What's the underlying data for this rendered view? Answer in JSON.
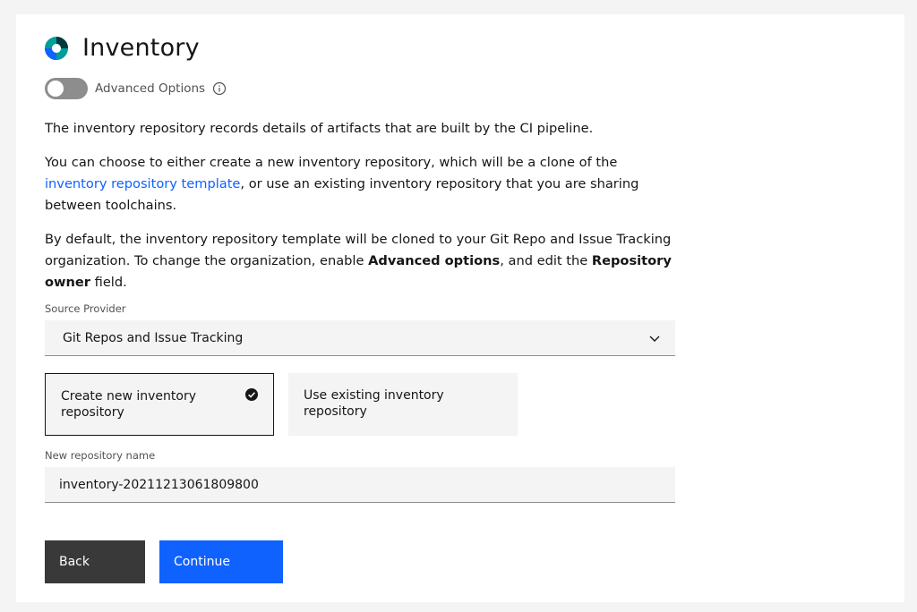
{
  "header": {
    "title": "Inventory",
    "logo_icon": "inventory-ring-logo",
    "colors": {
      "ring_dark": "#003a3a",
      "ring_teal": "#009d9a",
      "ring_blue": "#0f62fe"
    }
  },
  "advanced": {
    "label": "Advanced Options",
    "enabled": false,
    "info_icon": "info-icon"
  },
  "intro": {
    "p1": "The inventory repository records details of artifacts that are built by the CI pipeline.",
    "p2_before": "You can choose to either create a new inventory repository, which will be a clone of the ",
    "p2_link": "inventory repository template",
    "p2_after": ", or use an existing inventory repository that you are sharing between toolchains.",
    "p3_before": "By default, the inventory repository template will be cloned to your Git Repo and Issue Tracking organization. To change the organization, enable ",
    "p3_bold1": "Advanced options",
    "p3_mid": ", and edit the ",
    "p3_bold2": "Repository owner",
    "p3_after": " field."
  },
  "source_provider": {
    "label": "Source Provider",
    "value": "Git Repos and Issue Tracking"
  },
  "tiles": {
    "create": {
      "label": "Create new inventory repository",
      "selected": true
    },
    "existing": {
      "label": "Use existing inventory repository",
      "selected": false
    }
  },
  "repo_name": {
    "label": "New repository name",
    "value": "inventory-20211213061809800"
  },
  "buttons": {
    "back": "Back",
    "continue": "Continue"
  },
  "colors": {
    "primary": "#0f62fe",
    "secondary": "#393939",
    "link": "#0f62fe"
  }
}
